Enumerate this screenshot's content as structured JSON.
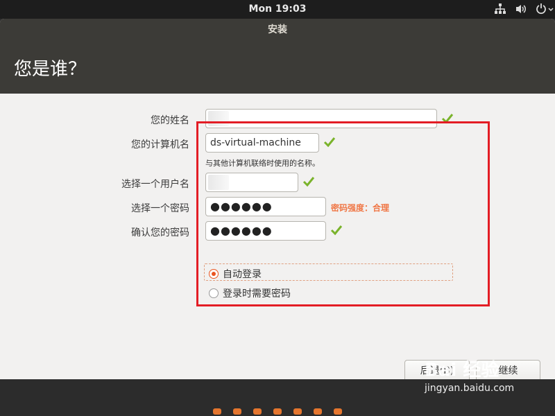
{
  "topbar": {
    "clock": "Mon 19:03",
    "icons": [
      "network-icon",
      "volume-icon",
      "power-icon"
    ]
  },
  "window": {
    "title": "安装",
    "heading": "您是谁？"
  },
  "form": {
    "name_label": "您的姓名",
    "name_value": "",
    "computer_label": "您的计算机名",
    "computer_value": "ds-virtual-machine",
    "computer_hint": "与其他计算机联络时使用的名称。",
    "username_label": "选择一个用户名",
    "username_value": "",
    "password_label": "选择一个密码",
    "password_value": "●●●●●●",
    "password_strength": "密码强度：合理",
    "confirm_label": "确认您的密码",
    "confirm_value": "●●●●●●",
    "radio_auto_login": "自动登录",
    "radio_require_password": "登录时需要密码",
    "selected_option": "自动登录"
  },
  "buttons": {
    "back": "后退(B)",
    "continue": "继续"
  },
  "progress": {
    "total_steps": 7
  },
  "watermark": {
    "brand": "Bai 经验",
    "url": "jingyan.baidu.com"
  },
  "colors": {
    "accent": "#e95420",
    "highlight_box": "#e31d25",
    "strength_text": "#f07746",
    "check": "#7ab32b"
  }
}
